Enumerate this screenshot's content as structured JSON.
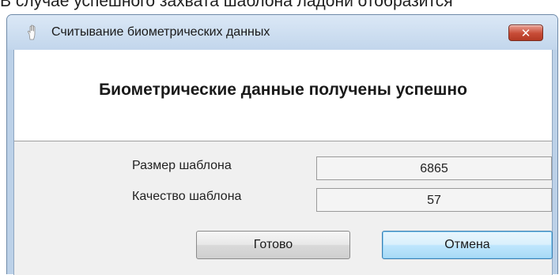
{
  "document": {
    "text": "В случае успешного захвата шаблона ладони отобразится"
  },
  "window": {
    "title": "Считывание биометрических данных",
    "title_icon": "hand-icon",
    "close_icon": "close-icon",
    "close_glyph": "✕"
  },
  "header": {
    "message": "Биометрические данные получены успешно"
  },
  "fields": [
    {
      "label": "Размер шаблона",
      "value": "6865"
    },
    {
      "label": "Качество шаблона",
      "value": "57"
    }
  ],
  "buttons": {
    "ok_label": "Готово",
    "cancel_label": "Отмена"
  }
}
